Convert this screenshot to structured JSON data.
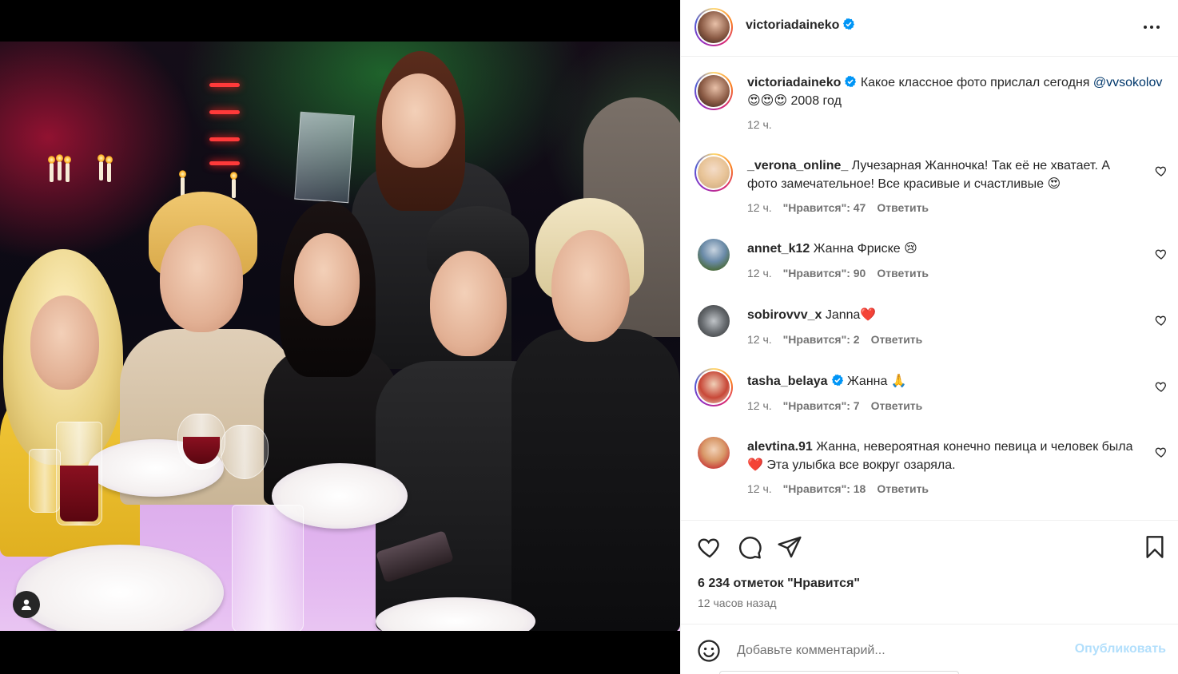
{
  "post": {
    "author": "victoriadaineko",
    "verified": true,
    "accent_color": "#0095f6"
  },
  "caption": {
    "username": "victoriadaineko",
    "text_before": " Какое классное фото прислал сегодня ",
    "mention": "@vvsokolov",
    "emojis": "😍😍😍",
    "text_after": " 2008 год",
    "time": "12 ч."
  },
  "comments": [
    {
      "username": "_verona_online_",
      "verified": false,
      "text": " Лучезарная Жанночка! Так её не хватает. А фото замечательное! Все красивые и счастливые 😍",
      "time": "12 ч.",
      "likes": "\"Нравится\": 47",
      "reply": "Ответить"
    },
    {
      "username": "annet_k12",
      "verified": false,
      "text": " Жанна Фриске 😢",
      "time": "12 ч.",
      "likes": "\"Нравится\": 90",
      "reply": "Ответить"
    },
    {
      "username": "sobirovvv_x",
      "verified": false,
      "text": " Janna❤️",
      "time": "12 ч.",
      "likes": "\"Нравится\": 2",
      "reply": "Ответить"
    },
    {
      "username": "tasha_belaya",
      "verified": true,
      "text": " Жанна 🙏",
      "time": "12 ч.",
      "likes": "\"Нравится\": 7",
      "reply": "Ответить"
    },
    {
      "username": "alevtina.91",
      "verified": false,
      "text": " Жанна, невероятная конечно певица и человек была ❤️ Эта улыбка все вокруг озаряла.",
      "time": "12 ч.",
      "likes": "\"Нравится\": 18",
      "reply": "Ответить"
    }
  ],
  "actions": {
    "likes": "6 234 отметок \"Нравится\"",
    "time_ago": "12 часов назад",
    "icons": [
      "heart-icon",
      "comment-icon",
      "share-icon",
      "bookmark-icon"
    ]
  },
  "comment_bar": {
    "placeholder": "Добавьте комментарий...",
    "publish_label": "Опубликовать"
  }
}
